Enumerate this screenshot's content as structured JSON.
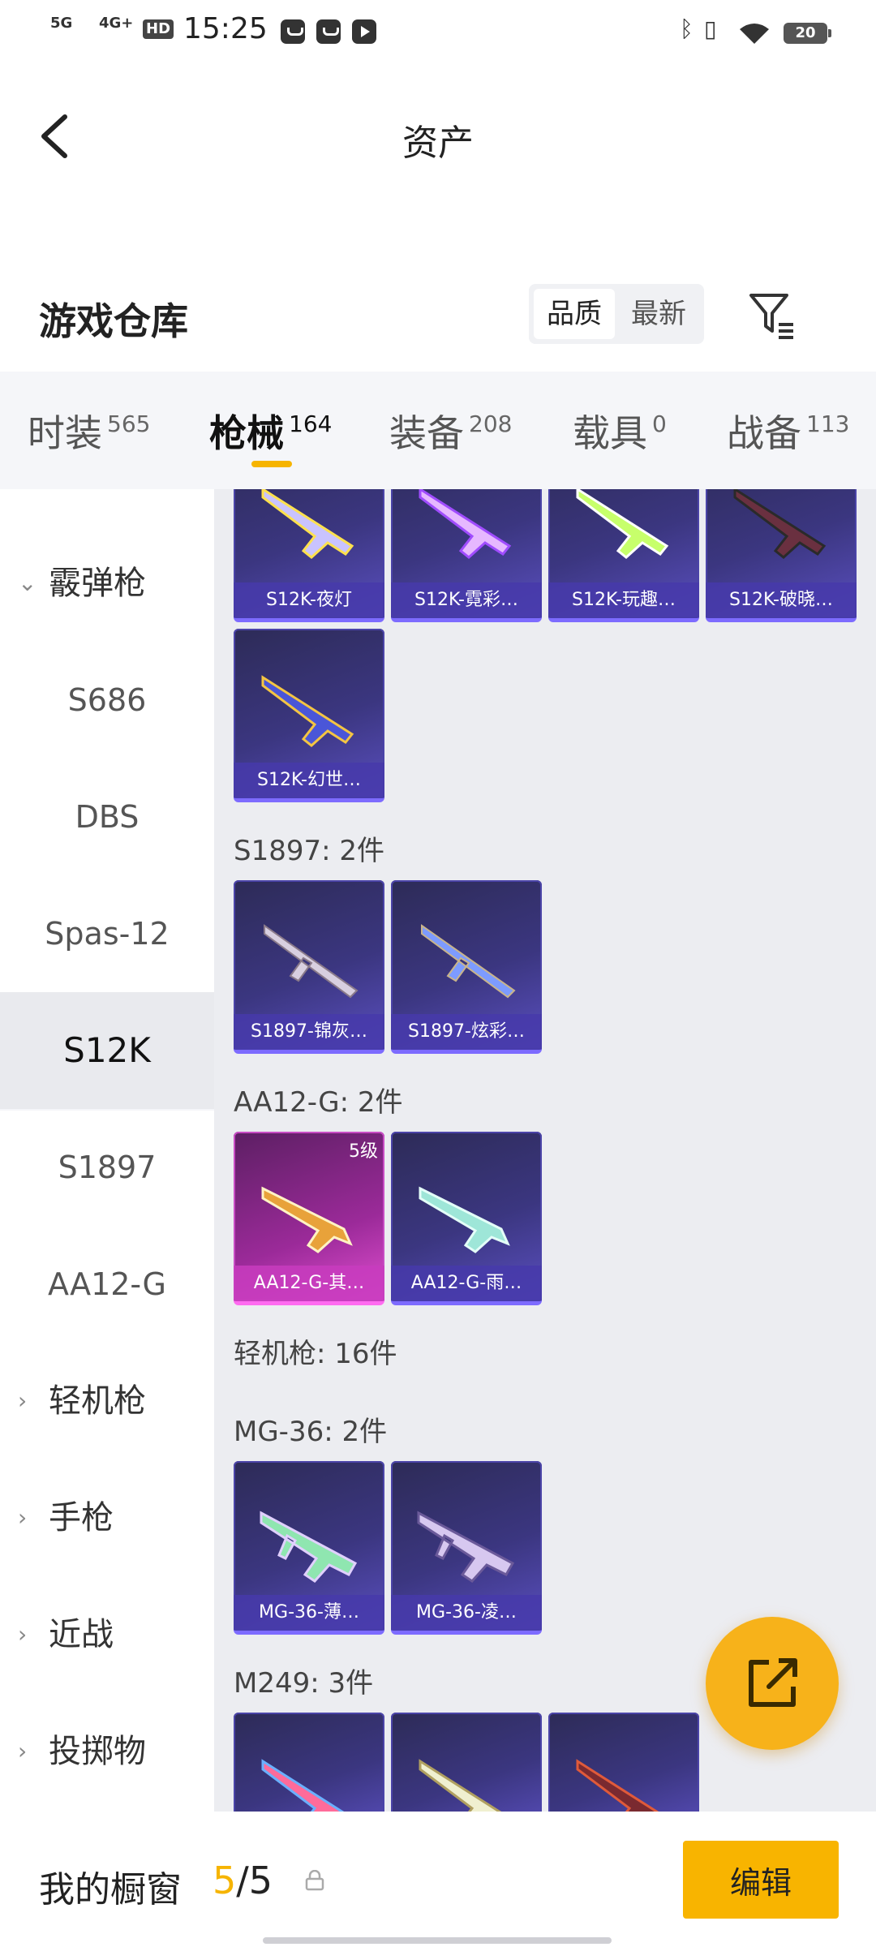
{
  "status_bar": {
    "network1": "5G",
    "network2": "4G+",
    "hd": "HD",
    "time": "15:25",
    "battery": "20"
  },
  "header": {
    "title": "资产"
  },
  "warehouse": {
    "title": "游戏仓库",
    "sort_options": [
      "品质",
      "最新"
    ],
    "active_sort": "品质"
  },
  "category_tabs": [
    {
      "label": "时装",
      "count": "565"
    },
    {
      "label": "枪械",
      "count": "164",
      "active": true
    },
    {
      "label": "装备",
      "count": "208"
    },
    {
      "label": "载具",
      "count": "0"
    },
    {
      "label": "战备",
      "count": "113"
    }
  ],
  "sidebar": {
    "groups": [
      {
        "label": "霰弹枪",
        "expanded": true
      },
      {
        "label": "轻机枪"
      },
      {
        "label": "手枪"
      },
      {
        "label": "近战"
      },
      {
        "label": "投掷物"
      }
    ],
    "items": [
      "S686",
      "DBS",
      "Spas-12",
      "S12K",
      "S1897",
      "AA12-G"
    ],
    "selected": "S12K"
  },
  "content": {
    "s12k_cards": [
      "S12K-夜灯",
      "S12K-霓彩…",
      "S12K-玩趣…",
      "S12K-破晓…",
      "S12K-幻世…"
    ],
    "s1897": {
      "title": "S1897: 2件",
      "cards": [
        "S1897-锦灰…",
        "S1897-炫彩…"
      ]
    },
    "aa12g": {
      "title": "AA12-G: 2件",
      "cards": [
        "AA12-G-其…",
        "AA12-G-雨…"
      ],
      "level_badge": "5级"
    },
    "lmg_title": "轻机枪: 16件",
    "mg36": {
      "title": "MG-36: 2件",
      "cards": [
        "MG-36-薄…",
        "MG-36-凌…"
      ]
    },
    "m249": {
      "title": "M249: 3件"
    }
  },
  "bottom": {
    "showcase_label": "我的橱窗",
    "current": "5",
    "total": "/5",
    "edit_label": "编辑"
  },
  "colors": {
    "accent": "#f6b400",
    "card_purple": "#3b3680",
    "card_pink": "#9b2a99"
  }
}
